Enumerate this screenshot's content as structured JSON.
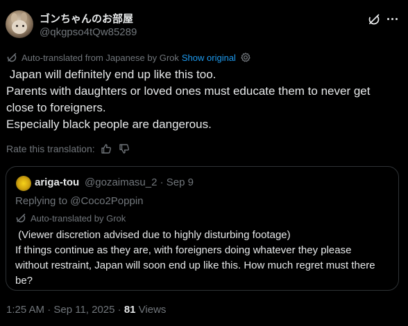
{
  "post": {
    "author": {
      "display_name": "ゴンちゃんのお部屋",
      "handle": "@qkgpso4tQw85289",
      "avatar_icon": "rabbit-avatar"
    },
    "translation": {
      "notice": "Auto-translated from Japanese by Grok",
      "show_original": "Show original",
      "rate_label": "Rate this translation:"
    },
    "text_lines": [
      " Japan will definitely end up like this too.",
      "Parents with daughters or loved ones must educate them to never get",
      "close to foreigners.",
      "Especially black people are dangerous."
    ],
    "timestamp": "1:25 AM · Sep 11, 2025 · ",
    "views_count": "81",
    "views_label": " Views"
  },
  "quote": {
    "author": {
      "display_name": "ariga-tou",
      "meta": "@gozaimasu_2 · Sep 9",
      "avatar_icon": "flower-avatar"
    },
    "replying_to": "Replying to @Coco2Poppin",
    "translation_notice": "Auto-translated by Grok",
    "text_lines": [
      " (Viewer discretion advised due to highly disturbing footage)",
      "If things continue as they are, with foreigners doing whatever they please",
      "without restraint, Japan will soon end up like this. How much regret must there",
      "be?"
    ]
  },
  "colors": {
    "background": "#000000",
    "text_primary": "#e7e9ea",
    "text_secondary": "#71767b",
    "link": "#1d9bf0",
    "border": "#2f3336"
  }
}
